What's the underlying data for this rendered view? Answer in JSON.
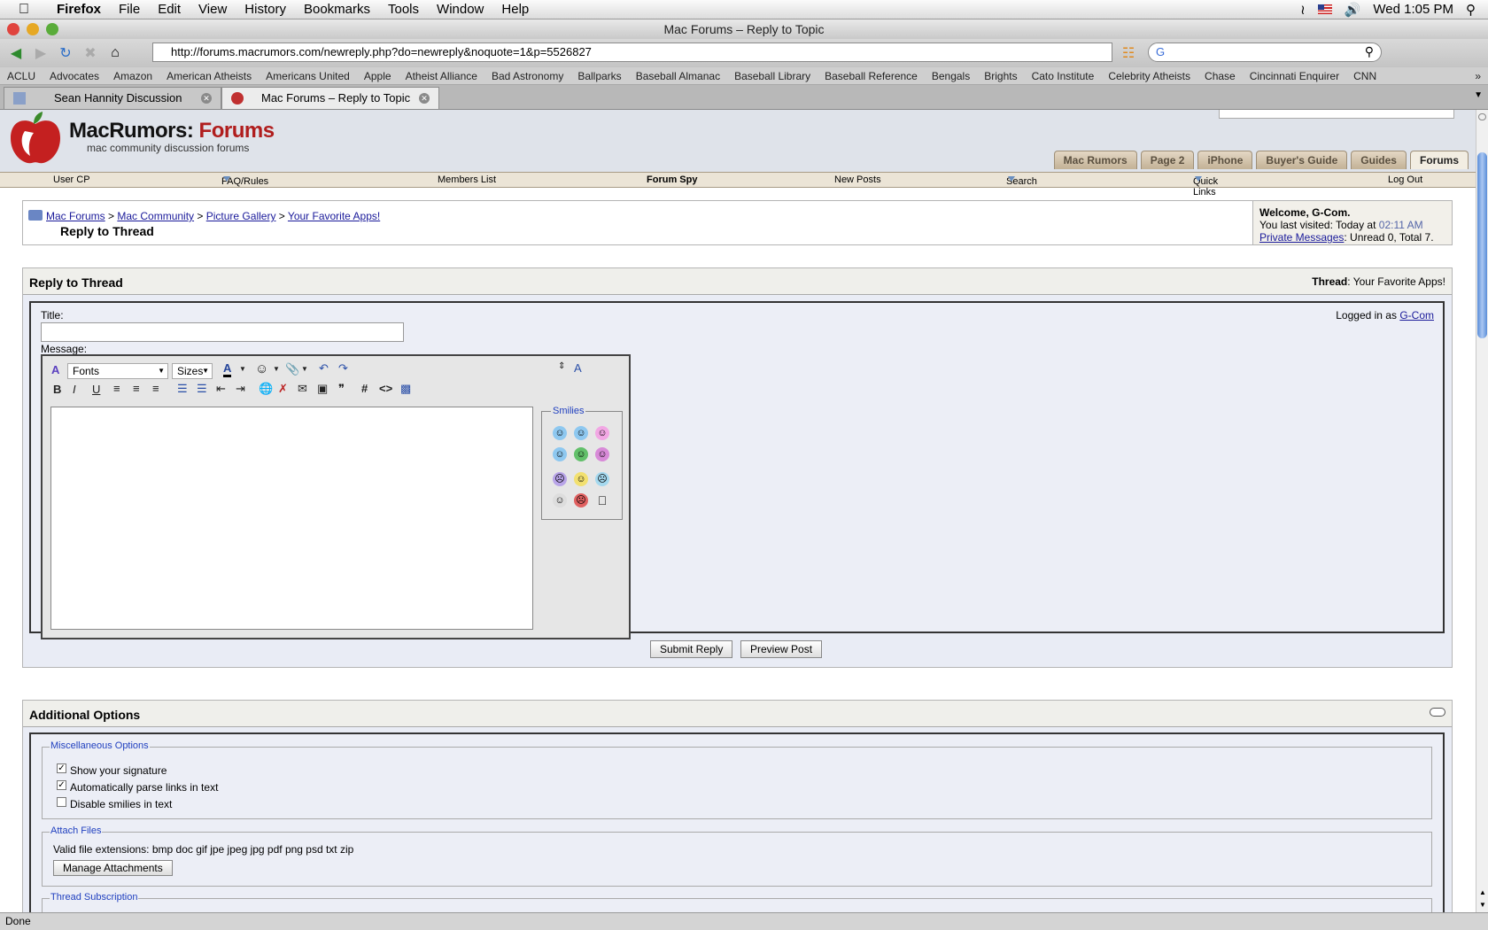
{
  "menubar": {
    "app": "Firefox",
    "items": [
      "File",
      "Edit",
      "View",
      "History",
      "Bookmarks",
      "Tools",
      "Window",
      "Help"
    ],
    "clock": "Wed 1:05 PM"
  },
  "window": {
    "title": "Mac Forums – Reply to Topic"
  },
  "toolbar": {
    "url": "http://forums.macrumors.com/newreply.php?do=newreply&noquote=1&p=5526827"
  },
  "bookmarks": [
    "ACLU",
    "Advocates",
    "Amazon",
    "American Atheists",
    "Americans United",
    "Apple",
    "Atheist Alliance",
    "Bad Astronomy",
    "Ballparks",
    "Baseball Almanac",
    "Baseball Library",
    "Baseball Reference",
    "Bengals",
    "Brights",
    "Cato Institute",
    "Celebrity Atheists",
    "Chase",
    "Cincinnati Enquirer",
    "CNN"
  ],
  "tabs": [
    "Sean Hannity Discussion",
    "Mac Forums – Reply to Topic"
  ],
  "site": {
    "logo_a": "MacRumors:",
    "logo_b": "Forums",
    "tagline": "mac community discussion forums",
    "navtabs": [
      "Mac Rumors",
      "Page 2",
      "iPhone",
      "Buyer's Guide",
      "Guides",
      "Forums"
    ],
    "subnav": [
      "User CP",
      "FAQ/Rules",
      "Members List",
      "Forum Spy",
      "New Posts",
      "Search",
      "Quick Links",
      "Log Out"
    ]
  },
  "breadcrumb": {
    "items": [
      "Mac Forums",
      "Mac Community",
      "Picture Gallery",
      "Your Favorite Apps!"
    ],
    "current": "Reply to Thread"
  },
  "welcome": {
    "line1": "Welcome, G-Com.",
    "visited": "You last visited: Today at",
    "time": "02:11 AM",
    "pm_link": "Private Messages",
    "pm_text": ": Unread 0, Total 7."
  },
  "reply": {
    "heading": "Reply to Thread",
    "thread_label": "Thread",
    "thread_name": ": Your Favorite Apps!",
    "title_label": "Title:",
    "logged_in": "Logged in as",
    "user": "G-Com",
    "message_label": "Message:",
    "fonts": "Fonts",
    "sizes": "Sizes",
    "smilies_label": "Smilies",
    "submit": "Submit Reply",
    "preview": "Preview Post"
  },
  "options": {
    "heading": "Additional Options",
    "misc_legend": "Miscellaneous Options",
    "checks": [
      {
        "label": "Show your signature",
        "checked": true
      },
      {
        "label": "Automatically parse links in text",
        "checked": true
      },
      {
        "label": "Disable smilies in text",
        "checked": false
      }
    ],
    "attach_legend": "Attach Files",
    "extensions": "Valid file extensions: bmp doc gif jpe jpeg jpg pdf png psd txt zip",
    "manage": "Manage Attachments",
    "sub_legend": "Thread Subscription"
  },
  "status": "Done"
}
